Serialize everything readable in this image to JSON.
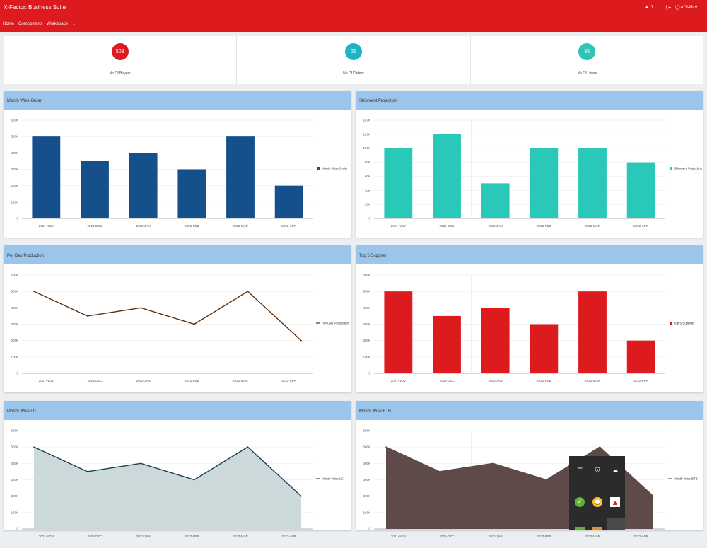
{
  "header": {
    "title": "X-Factor: Business Suite",
    "nav": [
      "Home",
      "Components",
      "Workspace"
    ],
    "notifications_count": "17",
    "user": "ADMIN"
  },
  "stats": [
    {
      "value": "503",
      "label": "No Of Buyers",
      "color": "#dd1b1f"
    },
    {
      "value": "25",
      "label": "No Of Orders",
      "color": "#1eb3c7"
    },
    {
      "value": "35",
      "label": "No Of Users",
      "color": "#2ec4b6"
    }
  ],
  "chart_data": [
    {
      "id": "month-wise-order",
      "type": "bar",
      "title": "Month Wise Order",
      "categories": [
        "2021-NOV",
        "2021-DEC",
        "2022-JAN",
        "2022-FEB",
        "2022-MAR",
        "2022-APR"
      ],
      "series": [
        {
          "name": "Month Wise Order",
          "values": [
            500000,
            350000,
            400000,
            300000,
            500000,
            200000
          ]
        }
      ],
      "yticks": [
        "0",
        "100K",
        "200K",
        "300K",
        "400K",
        "500K",
        "600K"
      ],
      "ylim": [
        0,
        600000
      ],
      "color": "#154f8c"
    },
    {
      "id": "shipment-projection",
      "type": "bar",
      "title": "Shipment Projection",
      "categories": [
        "2021-NOV",
        "2021-DEC",
        "2022-JAN",
        "2022-FEB",
        "2022-MAR",
        "2022-APR"
      ],
      "series": [
        {
          "name": "Shipment Projection",
          "values": [
            100000,
            120000,
            50000,
            100000,
            100000,
            80000
          ]
        }
      ],
      "yticks": [
        "0",
        "20K",
        "40K",
        "60K",
        "80K",
        "100K",
        "120K",
        "140K"
      ],
      "ylim": [
        0,
        140000
      ],
      "color": "#2ac8b8"
    },
    {
      "id": "per-day-production",
      "type": "line",
      "title": "Per Day Production",
      "categories": [
        "2021-NOV",
        "2021-DEC",
        "2022-JAN",
        "2022-FEB",
        "2022-MAR",
        "2022-APR"
      ],
      "series": [
        {
          "name": "Per Day Production",
          "values": [
            500000,
            350000,
            400000,
            300000,
            500000,
            200000
          ]
        }
      ],
      "yticks": [
        "0",
        "100K",
        "200K",
        "300K",
        "400K",
        "500K",
        "600K"
      ],
      "ylim": [
        0,
        600000
      ],
      "color": "#5a2e0e"
    },
    {
      "id": "top-5-supplier",
      "type": "bar",
      "title": "Top 5 Supplier",
      "categories": [
        "2021-NOV",
        "2021-DEC",
        "2022-JAN",
        "2022-FEB",
        "2022-MAR",
        "2022-APR"
      ],
      "series": [
        {
          "name": "Top 5 Supplier",
          "values": [
            500000,
            350000,
            400000,
            300000,
            500000,
            200000
          ]
        }
      ],
      "yticks": [
        "0",
        "100K",
        "200K",
        "300K",
        "400K",
        "500K",
        "600K"
      ],
      "ylim": [
        0,
        600000
      ],
      "color": "#dd1b1f"
    },
    {
      "id": "month-wise-lc",
      "type": "area",
      "title": "Month Wise LC",
      "categories": [
        "2021-NOV",
        "2021-DEC",
        "2022-JAN",
        "2022-FEB",
        "2022-MAR",
        "2022-APR"
      ],
      "series": [
        {
          "name": "Month Wise LC",
          "values": [
            500000,
            350000,
            400000,
            300000,
            500000,
            200000
          ]
        }
      ],
      "yticks": [
        "0",
        "100K",
        "200K",
        "300K",
        "400K",
        "500K",
        "600K"
      ],
      "ylim": [
        0,
        600000
      ],
      "color": "#1c3d4f",
      "fill": "#ccd9db"
    },
    {
      "id": "month-wise-btb",
      "type": "area",
      "title": "Month Wise BTB",
      "categories": [
        "2021-NOV",
        "2021-DEC",
        "2022-JAN",
        "2022-FEB",
        "2022-MAR",
        "2022-APR"
      ],
      "series": [
        {
          "name": "Month Wise BTB",
          "values": [
            500000,
            350000,
            400000,
            300000,
            500000,
            200000
          ]
        }
      ],
      "yticks": [
        "0",
        "100K",
        "200K",
        "300K",
        "400K",
        "500K",
        "600K"
      ],
      "ylim": [
        0,
        600000
      ],
      "color": "#5e4a48",
      "fill": "#5e4a48"
    }
  ],
  "tray": {
    "icons": [
      "speaker-icon",
      "shield-icon",
      "cloud-icon",
      "check-icon",
      "chrome-icon",
      "adobe-icon"
    ]
  }
}
